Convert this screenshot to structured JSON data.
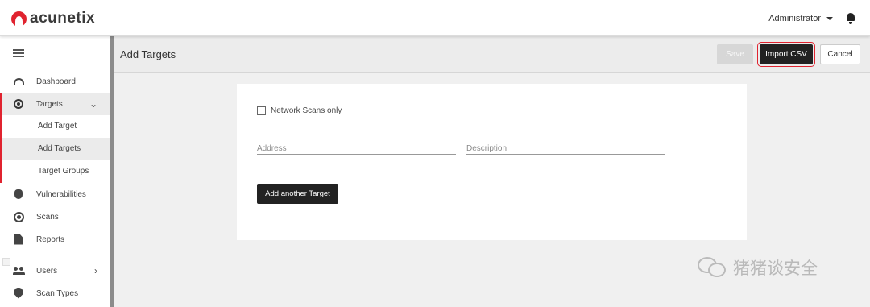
{
  "header": {
    "logo_text": "acunetix",
    "user_label": "Administrator"
  },
  "sidebar": {
    "items": [
      {
        "label": "Dashboard",
        "icon": "dashboard-gauge-icon"
      },
      {
        "label": "Targets",
        "icon": "target-icon",
        "expanded": true
      },
      {
        "label": "Vulnerabilities",
        "icon": "bug-icon"
      },
      {
        "label": "Scans",
        "icon": "radar-icon"
      },
      {
        "label": "Reports",
        "icon": "report-document-icon"
      },
      {
        "label": "Users",
        "icon": "users-icon"
      },
      {
        "label": "Scan Types",
        "icon": "shield-icon"
      }
    ],
    "target_subitems": [
      "Add Target",
      "Add Targets",
      "Target Groups"
    ],
    "accent_color": "#e0232f"
  },
  "page": {
    "title": "Add Targets",
    "buttons": {
      "save": "Save",
      "import_csv": "Import CSV",
      "cancel": "Cancel"
    }
  },
  "form": {
    "network_scans_only_label": "Network Scans only",
    "address_placeholder": "Address",
    "description_placeholder": "Description",
    "add_another_label": "Add another Target"
  },
  "watermark": {
    "text": "猪猪谈安全"
  }
}
